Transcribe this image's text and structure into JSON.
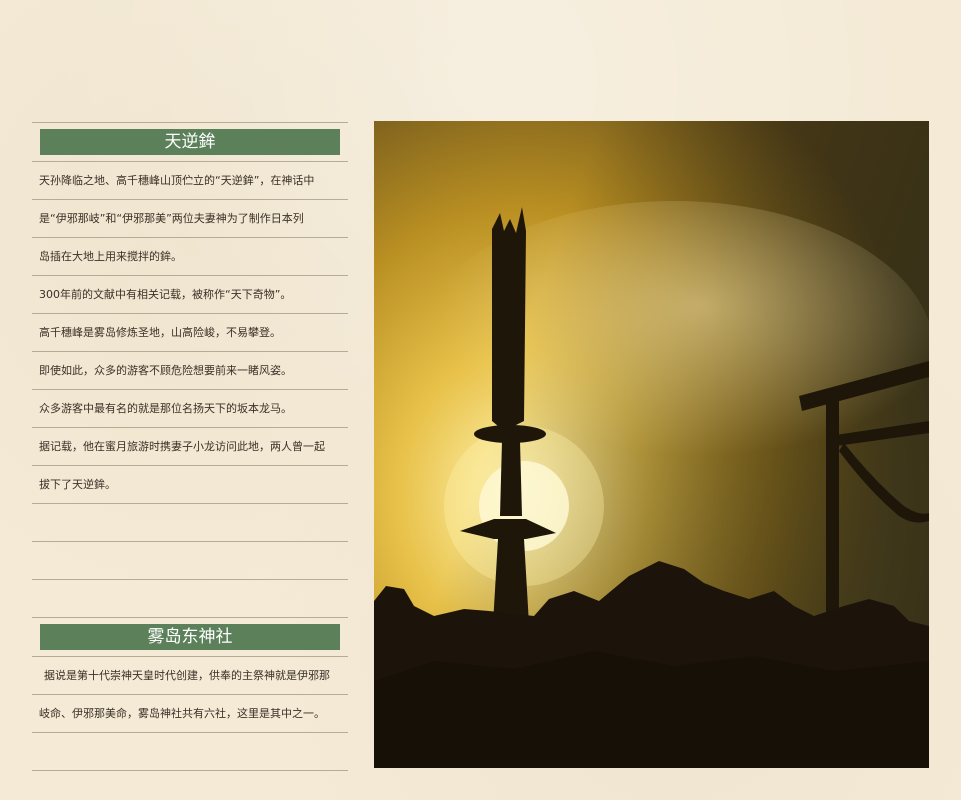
{
  "section1": {
    "title": "天逆鉾",
    "lines": [
      "天孙降临之地、高千穗峰山顶伫立的“天逆鉾”，在神话中",
      "是“伊邪那岐”和“伊邪那美”两位夫妻神为了制作日本列",
      "岛插在大地上用来搅拌的鉾。",
      "300年前的文献中有相关记载，被称作“天下奇物”。",
      "高千穗峰是雾岛修炼圣地，山高险峻，不易攀登。",
      "即使如此，众多的游客不顾危险想要前来一睹风姿。",
      "众多游客中最有名的就是那位名扬天下的坂本龙马。",
      "据记载，他在蜜月旅游时携妻子小龙访问此地，两人曾一起",
      "拔下了天逆鉾。"
    ]
  },
  "section2": {
    "title": "雾岛东神社",
    "lines": [
      "据说是第十代崇神天皇时代创建，供奉的主祭神就是伊邪那",
      "岐命、伊邪那美命，雾岛神社共有六社，这里是其中之一。"
    ]
  },
  "photo": {
    "subject": "sunset silhouette of sword and torii gate on mountain summit",
    "colors": {
      "sky_top": "#5a4a1e",
      "sky_glow": "#f7e27a",
      "sun": "#fff8d0",
      "silhouette": "#1c140a"
    }
  }
}
